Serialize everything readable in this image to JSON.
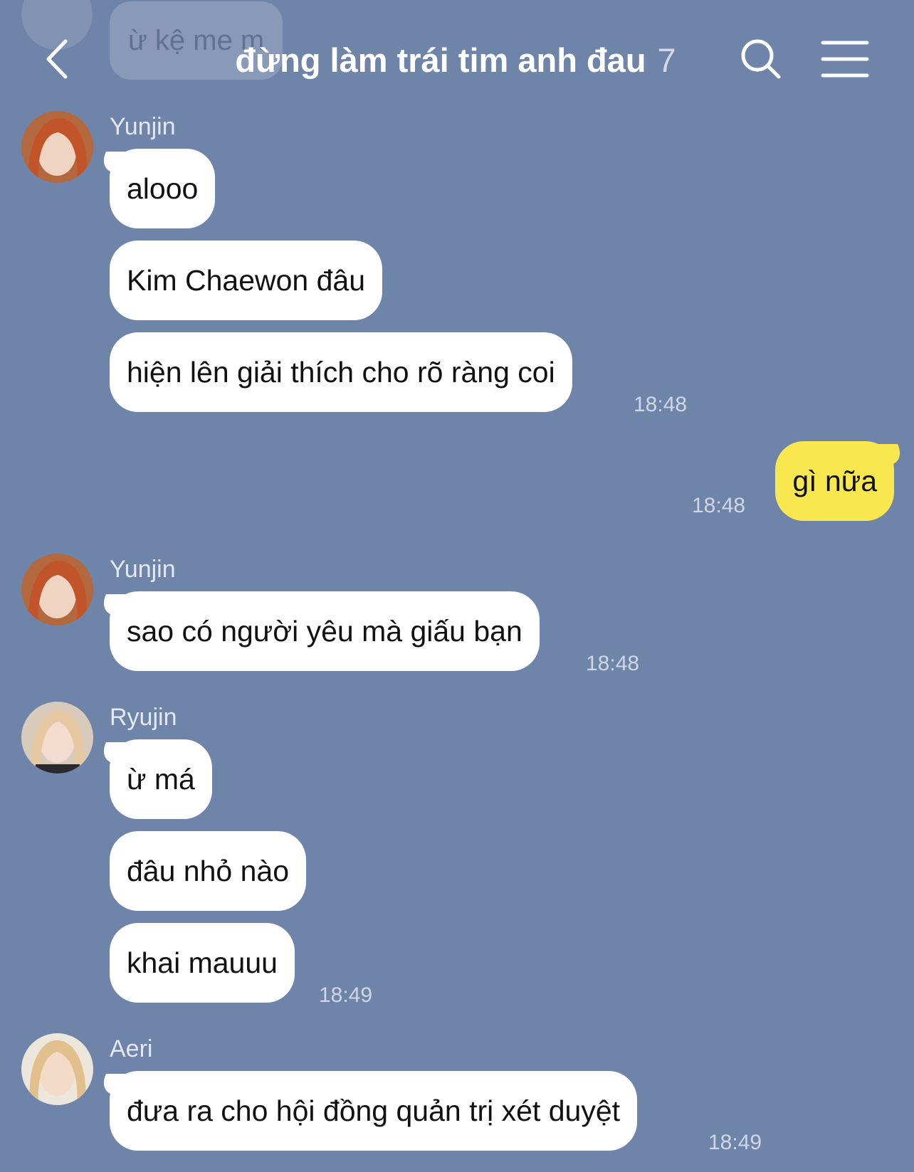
{
  "header": {
    "back_icon": "chevron-left-icon",
    "title": "đừng làm trái tim anh đau",
    "member_count": "7",
    "search_icon": "search-icon",
    "menu_icon": "hamburger-menu-icon"
  },
  "ghost_message": {
    "text": "ừ kệ me m"
  },
  "messages": [
    {
      "sender": "Yunjin",
      "bubbles": [
        "alooo",
        "Kim Chaewon đâu",
        "hiện lên giải thích cho rõ ràng coi"
      ],
      "time": "18:48"
    },
    {
      "mine": true,
      "bubbles": [
        "gì nữa"
      ],
      "time": "18:48"
    },
    {
      "sender": "Yunjin",
      "bubbles": [
        "sao có người yêu mà giấu bạn"
      ],
      "time": "18:48"
    },
    {
      "sender": "Ryujin",
      "bubbles": [
        "ừ má",
        "đâu nhỏ nào",
        "khai mauuu"
      ],
      "time": "18:49"
    },
    {
      "sender": "Aeri",
      "bubbles": [
        "đưa ra cho hội đồng quản trị xét duyệt"
      ],
      "time": "18:49"
    }
  ],
  "colors": {
    "background": "#6f84a9",
    "incoming_bubble": "#ffffff",
    "outgoing_bubble": "#f8e74f",
    "timestamp": "#cfd7e5"
  }
}
